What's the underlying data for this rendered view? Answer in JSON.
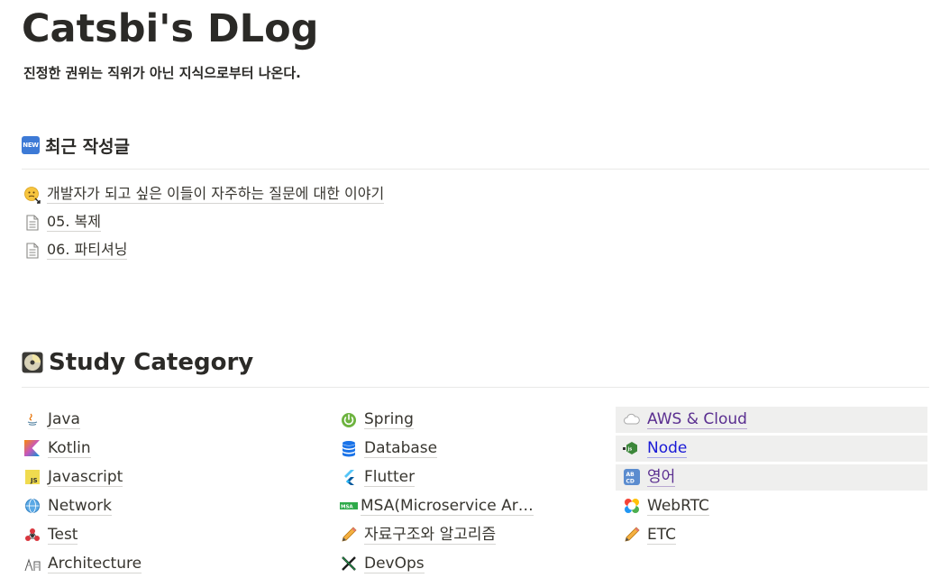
{
  "site": {
    "title": "Catsbi's DLog",
    "subtitle": "진정한 권위는 직위가 아닌 지식으로부터 나온다."
  },
  "recent": {
    "heading": "최근 작성글",
    "badge": "NEW",
    "items": [
      {
        "label": "개발자가 되고 싶은 이들이 자주하는 질문에 대한 이야기",
        "icon": "thinking-face-icon"
      },
      {
        "label": "05. 복제",
        "icon": "page-icon"
      },
      {
        "label": "06. 파티셔닝",
        "icon": "page-icon"
      }
    ]
  },
  "study": {
    "heading": "Study Category",
    "columns": [
      [
        {
          "label": "Java",
          "icon": "java-icon"
        },
        {
          "label": "Kotlin",
          "icon": "kotlin-icon"
        },
        {
          "label": "Javascript",
          "icon": "javascript-icon"
        },
        {
          "label": "Network",
          "icon": "network-globe-icon"
        },
        {
          "label": "Test",
          "icon": "test-molecule-icon"
        },
        {
          "label": "Architecture",
          "icon": "architecture-icon"
        }
      ],
      [
        {
          "label": "Spring",
          "icon": "spring-icon"
        },
        {
          "label": "Database",
          "icon": "database-icon"
        },
        {
          "label": "Flutter",
          "icon": "flutter-icon"
        },
        {
          "label": "MSA(Microservice Ar…",
          "icon": "msa-icon"
        },
        {
          "label": "자료구조와 알고리즘",
          "icon": "pencil-icon"
        },
        {
          "label": "DevOps",
          "icon": "devops-icon"
        }
      ],
      [
        {
          "label": "AWS & Cloud",
          "icon": "cloud-icon"
        },
        {
          "label": "Node",
          "icon": "node-icon"
        },
        {
          "label": "영어",
          "icon": "abcd-icon"
        },
        {
          "label": "WebRTC",
          "icon": "webrtc-icon"
        },
        {
          "label": "ETC",
          "icon": "pencil-icon"
        }
      ]
    ]
  },
  "colors": {
    "text": "#37352f",
    "highlight_bg": "#efefee",
    "purple_link": "#5a2e90",
    "blue_link": "#1a1ad6"
  }
}
